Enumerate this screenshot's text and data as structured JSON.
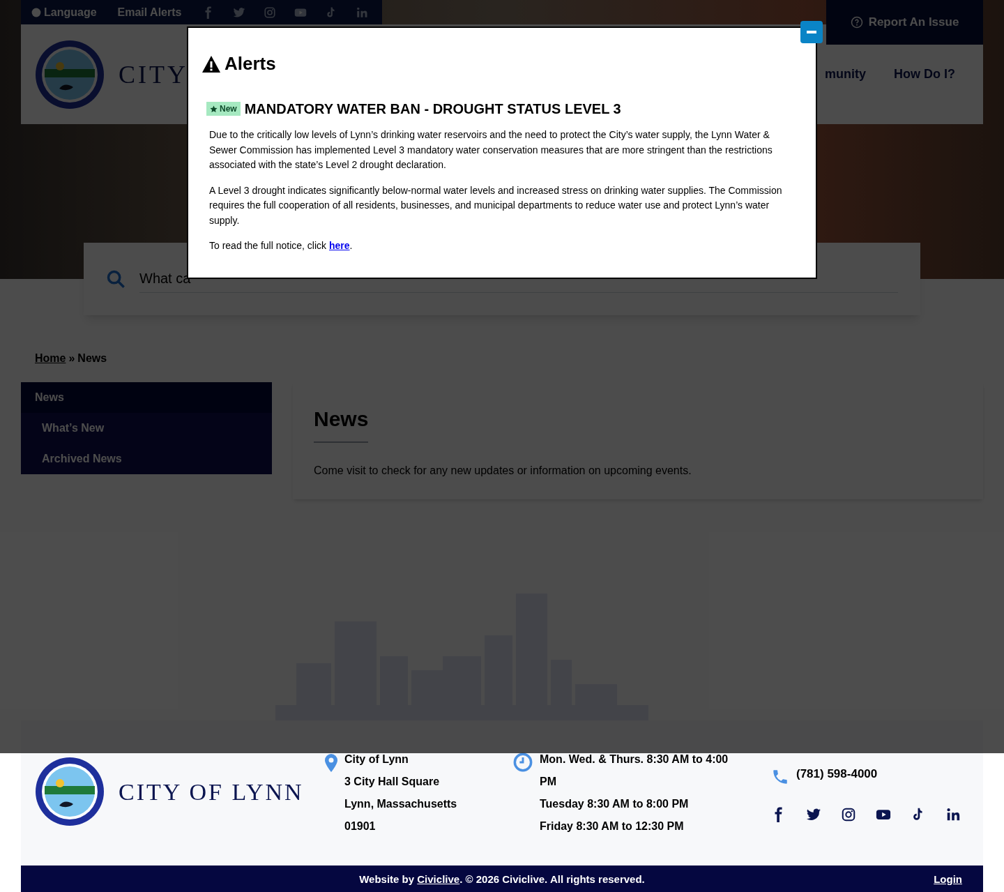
{
  "top_bar": {
    "language": "Language",
    "email_alerts": "Email Alerts"
  },
  "report_link": "Report An Issue",
  "header": {
    "site_name": "CITY",
    "nav": [
      "munity",
      "How Do I?"
    ]
  },
  "search": {
    "placeholder": "What ca"
  },
  "breadcrumb": {
    "home": "Home",
    "separator": "»",
    "current": "News"
  },
  "sidebar": {
    "title": "News",
    "items": [
      {
        "label": "What’s New"
      },
      {
        "label": "Archived News"
      }
    ]
  },
  "content": {
    "title": "News",
    "text": "Come visit to check for any new updates or information on upcoming events."
  },
  "footer": {
    "site_name": "CITY OF LYNN",
    "address": [
      "City of Lynn",
      "3 City Hall Square",
      "Lynn, Massachusetts",
      "01901"
    ],
    "hours": [
      "Mon. Wed. & Thurs. 8:30 AM to 4:00 PM",
      "Tuesday 8:30 AM to 8:00 PM",
      "Friday 8:30 AM to 12:30 PM"
    ],
    "phone": "(781) 598-4000",
    "credit_prefix": "Website by ",
    "credit_link": "Civiclive",
    "credit_suffix": ". © 2026 Civiclive. All rights reserved.",
    "login": "Login"
  },
  "alert_dialog": {
    "title": "Alerts",
    "items": [
      {
        "badge": "New",
        "title": "MANDATORY WATER BAN - DROUGHT STATUS LEVEL 3",
        "paragraphs": [
          "Due to the critically low levels of Lynn’s drinking water reservoirs and the need to protect the City’s water supply, the Lynn Water & Sewer Commission has implemented Level 3 mandatory water conservation measures that are more stringent than the restrictions associated with the state’s Level 2 drought declaration.",
          "A Level 3 drought indicates significantly below-normal water levels and increased stress on drinking water supplies. The Commission requires the full cooperation of all residents, businesses, and municipal departments to reduce water use and protect Lynn’s water supply."
        ],
        "link_prefix": "To read the full notice, click ",
        "link": "here",
        "link_suffix": "."
      }
    ]
  }
}
